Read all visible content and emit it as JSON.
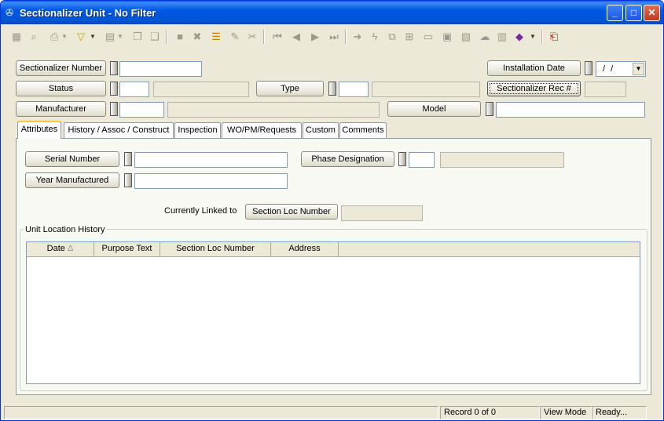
{
  "window": {
    "title": "Sectionalizer Unit - No Filter"
  },
  "toolbar": {
    "icons": [
      "grid-icon",
      "preview-icon",
      "print-icon",
      "filter-icon",
      "filter-dropdown",
      "sheet-icon",
      "sheet-dropdown",
      "copy-icon",
      "paste-icon",
      "save-icon",
      "delete-icon",
      "stack-icon",
      "edit-icon",
      "cut-icon",
      "first-record-icon",
      "prev-record-icon",
      "next-record-icon",
      "last-record-icon",
      "goto-icon",
      "lightning-icon",
      "link-icon",
      "tree-icon",
      "form-icon",
      "calc-icon",
      "map-icon",
      "cloud-icon",
      "table-icon",
      "book-icon",
      "book-dropdown",
      "exit-icon"
    ]
  },
  "header": {
    "sectionalizer_number_label": "Sectionalizer Number",
    "sectionalizer_number_value": "",
    "installation_date_label": "Installation Date",
    "installation_date_value": "/ /",
    "status_label": "Status",
    "status_code": "",
    "status_desc": "",
    "type_label": "Type",
    "type_code": "",
    "type_desc": "",
    "rec_label": "Sectionalizer Rec #",
    "rec_value": "",
    "manufacturer_label": "Manufacturer",
    "manufacturer_code": "",
    "manufacturer_desc": "",
    "model_label": "Model",
    "model_value": ""
  },
  "tabs": [
    {
      "label": "Attributes",
      "active": true
    },
    {
      "label": "History / Assoc / Construct"
    },
    {
      "label": "Inspection"
    },
    {
      "label": "WO/PM/Requests"
    },
    {
      "label": "Custom"
    },
    {
      "label": "Comments"
    }
  ],
  "attributes": {
    "serial_number_label": "Serial Number",
    "serial_number_value": "",
    "phase_label": "Phase Designation",
    "phase_code": "",
    "phase_desc": "",
    "year_label": "Year Manufactured",
    "year_value": "",
    "linked_label": "Currently Linked to",
    "section_loc_button": "Section Loc Number",
    "section_loc_value": ""
  },
  "history": {
    "group_label": "Unit Location History",
    "columns": [
      "Date",
      "Purpose Text",
      "Section Loc Number",
      "Address"
    ],
    "sort_indicator": "Δ",
    "rows": []
  },
  "status_bar": {
    "record": "Record 0 of 0",
    "mode": "View Mode",
    "state": "Ready..."
  }
}
